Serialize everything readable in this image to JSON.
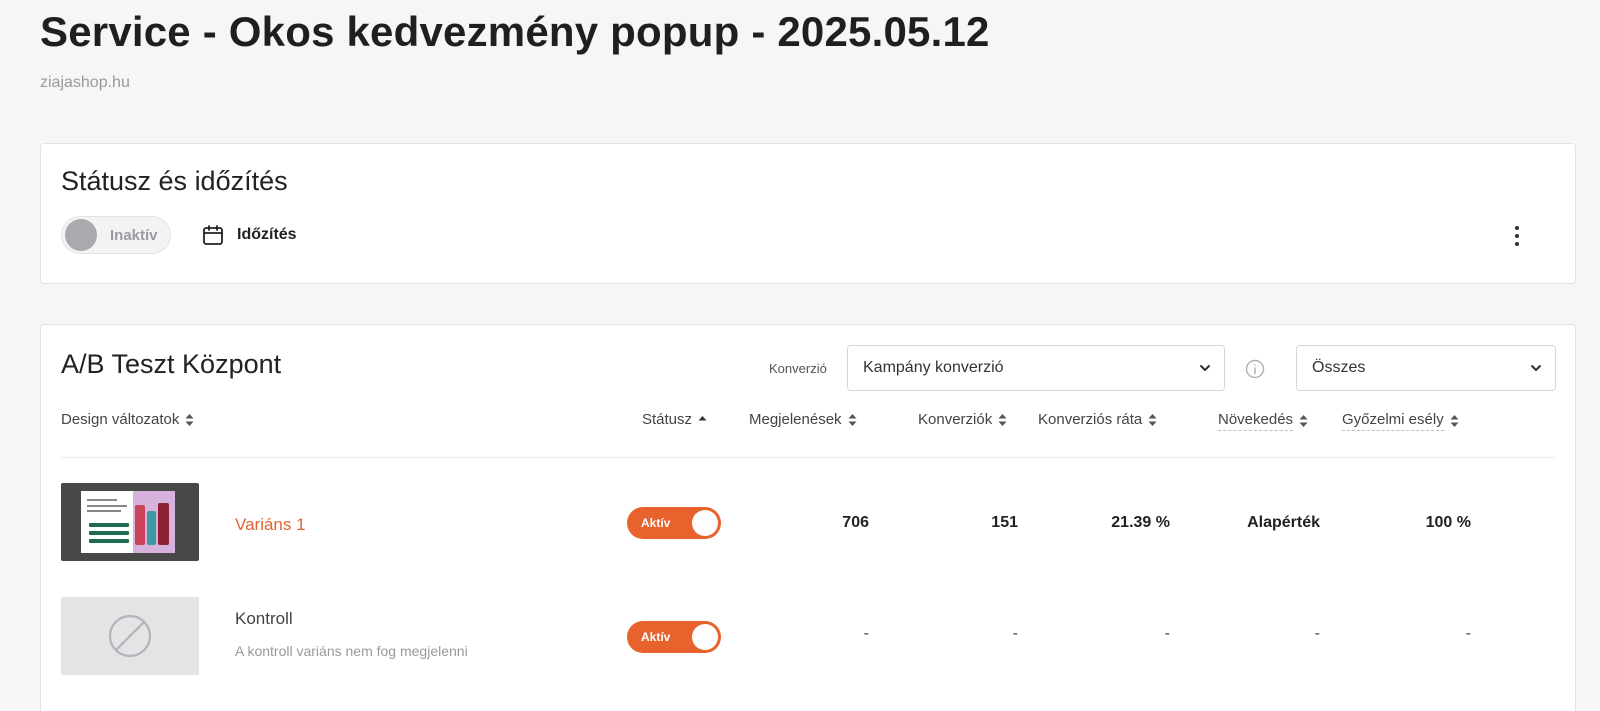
{
  "page": {
    "title": "Service - Okos kedvezmény popup - 2025.05.12",
    "subtitle": "ziajashop.hu"
  },
  "status_card": {
    "heading": "Státusz és időzítés",
    "toggle_label": "Inaktív",
    "schedule_label": "Időzítés"
  },
  "ab_card": {
    "heading": "A/B Teszt Központ",
    "conversion_label": "Konverzió",
    "conversion_select": "Kampány konverzió",
    "filter_select": "Összes",
    "columns": [
      "Design változatok",
      "Státusz",
      "Megjelenések",
      "Konverziók",
      "Konverziós ráta",
      "Növekedés",
      "Győzelmi esély"
    ],
    "rows": [
      {
        "name": "Variáns 1",
        "note": "",
        "status": "Aktív",
        "impressions": "706",
        "conversions": "151",
        "rate": "21.39 %",
        "growth": "Alapérték",
        "win_chance": "100 %"
      },
      {
        "name": "Kontroll",
        "note": "A kontroll variáns nem fog megjelenni",
        "status": "Aktív",
        "impressions": "-",
        "conversions": "-",
        "rate": "-",
        "growth": "-",
        "win_chance": "-"
      }
    ]
  },
  "colors": {
    "accent": "#e8622e",
    "inactive_knob": "#a9aaad",
    "variant_link": "#e2632f"
  },
  "icons": [
    "calendar-icon",
    "more-vertical-icon",
    "chevron-down-icon",
    "info-icon",
    "sort-icon",
    "sort-up-icon",
    "no-symbol-icon"
  ]
}
